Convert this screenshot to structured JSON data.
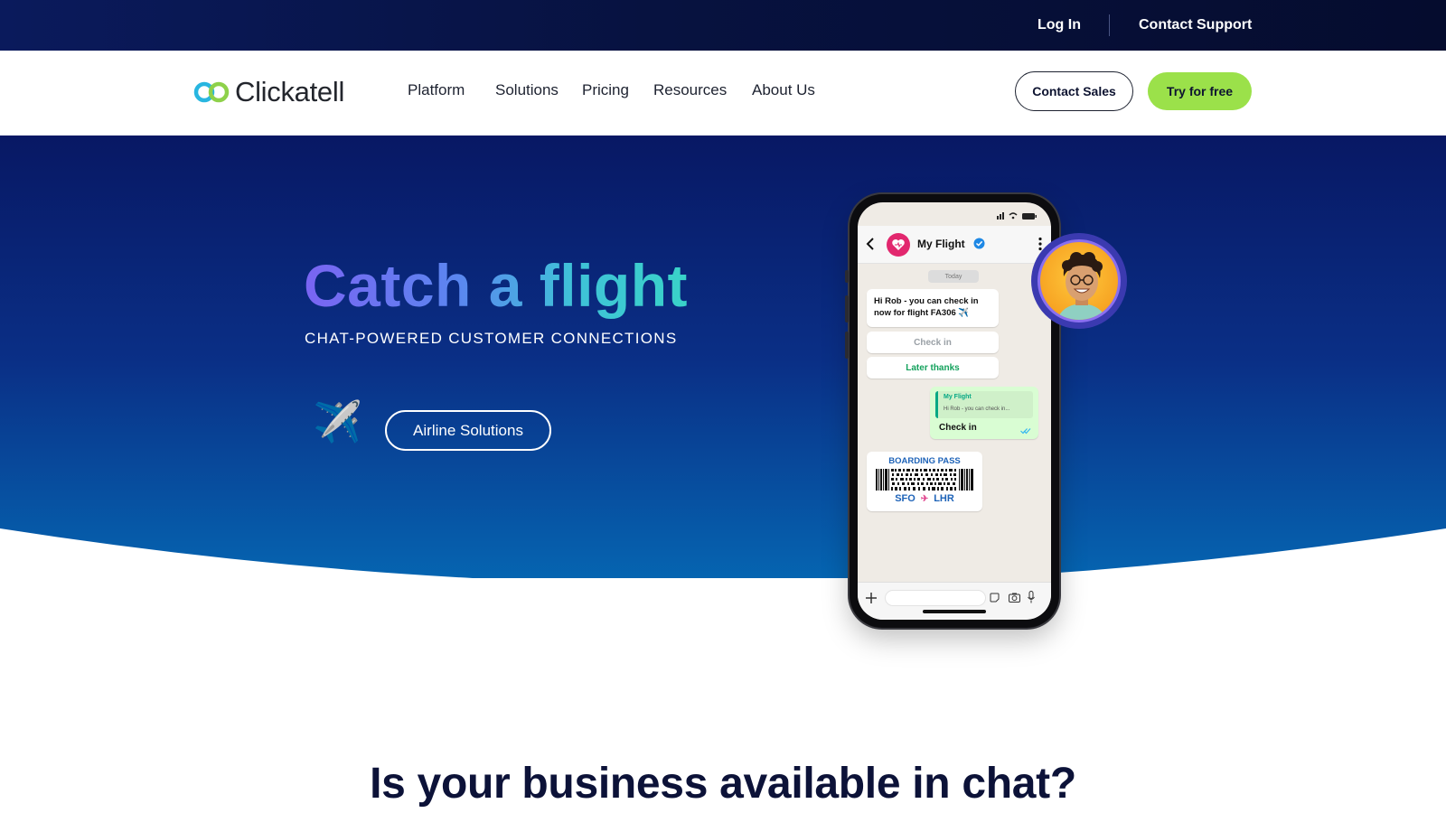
{
  "topbar": {
    "login_label": "Log In",
    "support_label": "Contact Support"
  },
  "nav": {
    "logo_text": "Clickatell",
    "items": [
      {
        "label": "Platform"
      },
      {
        "label": "Solutions"
      },
      {
        "label": "Pricing"
      },
      {
        "label": "Resources"
      },
      {
        "label": "About Us"
      }
    ],
    "contact_sales_label": "Contact Sales",
    "try_free_label": "Try for free"
  },
  "hero": {
    "title": "Catch a flight",
    "subtitle": "CHAT-POWERED CUSTOMER CONNECTIONS",
    "plane_emoji": "✈️",
    "cta_label": "Airline Solutions"
  },
  "phone": {
    "chat_name": "My Flight",
    "date_chip": "Today",
    "message": "Hi Rob - you can check in now for flight FA306 ✈️",
    "quick_replies": [
      "Check in",
      "Later thanks"
    ],
    "sent": {
      "quote_title": "My Flight",
      "quote_text": "Hi Rob - you can check in...",
      "text": "Check in"
    },
    "boarding_pass": {
      "title": "BOARDING PASS",
      "from": "SFO",
      "to": "LHR"
    }
  },
  "section": {
    "headline": "Is your business available in chat?"
  },
  "colors": {
    "topbar": "#071240",
    "hero_dark": "#071a6a",
    "hero_light": "#0564b0",
    "accent_green": "#9be14a",
    "title_gradient_start": "#7a64f2",
    "title_gradient_end": "#39d3c8"
  },
  "icons": [
    "clickatell-logo-icon",
    "airplane-icon",
    "back-icon",
    "heart-icon",
    "verified-icon",
    "menu-icon",
    "plus-icon",
    "sticker-icon",
    "camera-icon",
    "mic-icon",
    "read-ticks-icon"
  ]
}
